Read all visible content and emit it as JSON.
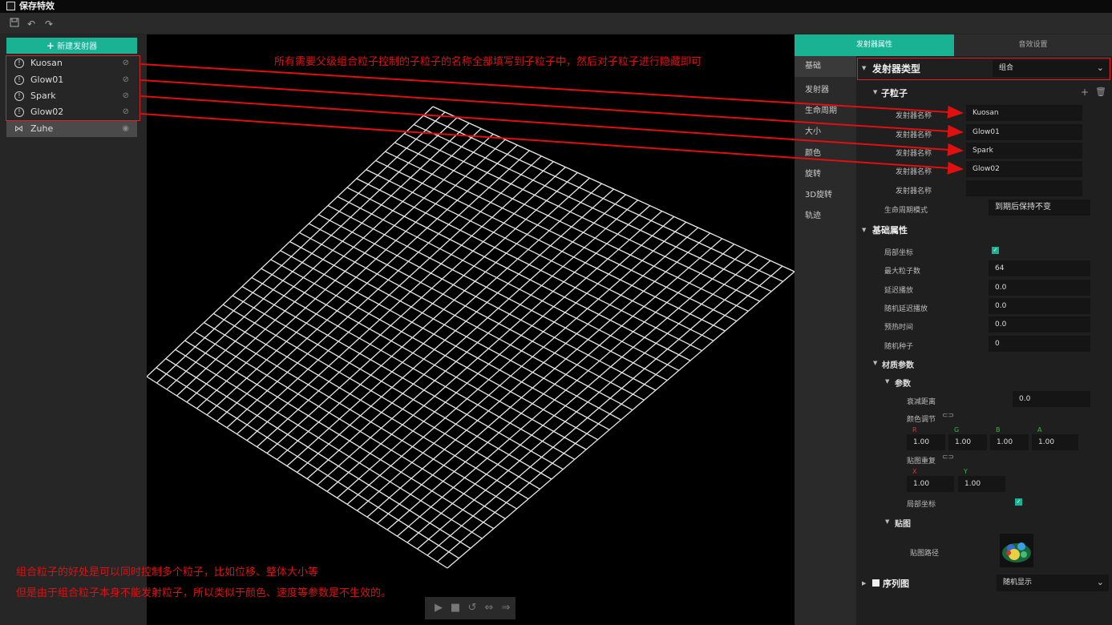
{
  "app": {
    "title": "保存特效"
  },
  "toolbar": {
    "icons": [
      "save-icon",
      "undo-icon",
      "redo-icon"
    ]
  },
  "emitters_panel": {
    "new_button": "新建发射器",
    "items": [
      {
        "name": "Kuosan",
        "icon": "info-icon",
        "hidden": true
      },
      {
        "name": "Glow01",
        "icon": "info-icon",
        "hidden": true
      },
      {
        "name": "Spark",
        "icon": "info-icon",
        "hidden": true
      },
      {
        "name": "Glow02",
        "icon": "info-icon",
        "hidden": true
      },
      {
        "name": "Zuhe",
        "icon": "combine-icon",
        "hidden": false,
        "selected": true
      }
    ]
  },
  "tabs": {
    "emitter_props": "发射器属性",
    "audio_settings": "音效设置"
  },
  "categories": [
    "基础",
    "发射器",
    "生命周期",
    "大小",
    "颜色",
    "旋转",
    "3D旋转",
    "轨迹"
  ],
  "props": {
    "emitter_type_label": "发射器类型",
    "emitter_type_value": "组合",
    "children_label": "子粒子",
    "child_label": "发射器名称",
    "children": [
      "Kuosan",
      "Glow01",
      "Spark",
      "Glow02",
      ""
    ],
    "lifecycle_mode_label": "生命周期模式",
    "lifecycle_mode_value": "到期后保持不变",
    "basic_label": "基础属性",
    "local_coord_label": "局部坐标",
    "max_particles_label": "最大粒子数",
    "max_particles_value": "64",
    "delay_label": "延迟播放",
    "delay_value": "0.0",
    "random_delay_label": "随机延迟播放",
    "random_delay_value": "0.0",
    "prewarm_label": "预热时间",
    "prewarm_value": "0.0",
    "seed_label": "随机种子",
    "seed_value": "0",
    "material_label": "材质参数",
    "params_label": "参数",
    "fade_label": "衰减距离",
    "fade_value": "0.0",
    "color_adjust_label": "颜色调节",
    "r": "R",
    "g": "G",
    "b": "B",
    "a": "A",
    "r_value": "1.00",
    "g_value": "1.00",
    "b_value": "1.00",
    "a_value": "1.00",
    "tiling_label": "贴图重复",
    "x": "X",
    "y": "Y",
    "x_value": "1.00",
    "y_value": "1.00",
    "local_coord2_label": "局部坐标",
    "texture_label": "贴图",
    "texture_path_label": "贴图路径",
    "sequence_label": "序列图",
    "sequence_value": "随机显示"
  },
  "annotations": {
    "top": "所有需要父级组合粒子控制的子粒子的名称全部填写到子粒子中，然后对子粒子进行隐藏即可",
    "bottom_line1": "组合粒子的好处是可以同时控制多个粒子，比如位移、整体大小等",
    "bottom_line2": "但是由于组合粒子本身不能发射粒子，所以类似于颜色、速度等参数是不生效的。"
  },
  "colors": {
    "accent": "#19b394",
    "annotation": "#e01010"
  }
}
